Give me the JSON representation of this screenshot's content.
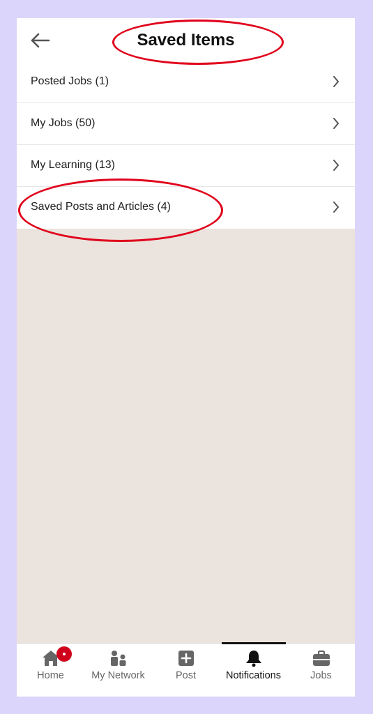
{
  "header": {
    "title": "Saved Items",
    "back_icon": "back-arrow-icon"
  },
  "list": {
    "items": [
      {
        "label": "Posted Jobs (1)",
        "icon": "chevron-right-icon"
      },
      {
        "label": "My Jobs (50)",
        "icon": "chevron-right-icon"
      },
      {
        "label": "My Learning (13)",
        "icon": "chevron-right-icon"
      },
      {
        "label": "Saved Posts and Articles (4)",
        "icon": "chevron-right-icon"
      }
    ]
  },
  "nav": {
    "items": [
      {
        "label": "Home",
        "icon": "home-icon",
        "badge": true
      },
      {
        "label": "My Network",
        "icon": "network-icon"
      },
      {
        "label": "Post",
        "icon": "plus-square-icon"
      },
      {
        "label": "Notifications",
        "icon": "bell-icon",
        "active": true
      },
      {
        "label": "Jobs",
        "icon": "briefcase-icon"
      }
    ]
  },
  "colors": {
    "annotation": "#e0001b",
    "badge": "#d0021b",
    "content_bg": "#ebe3dd",
    "frame_bg": "#dcd5fb"
  }
}
